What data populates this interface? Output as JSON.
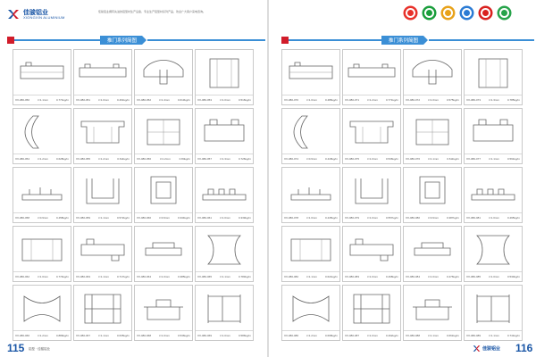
{
  "left_page": {
    "brand_cn": "佳骏铝业",
    "brand_en": "XIONGXIN ALUMINIUM",
    "intro_text": "佳骏铝业拥有先进的铝型材生产设备，专业生产铝型材系列产品，欢迎广大客户来电咨询。",
    "section_title": "推门系列简图",
    "page_number": "115",
    "footnote": "铝型 · 佳骏铝业",
    "cells": [
      {
        "code": "XX-080-050",
        "thick": "t=1.1mm",
        "weight": "0.771kg/m"
      },
      {
        "code": "XX-080-051",
        "thick": "t=1.0mm",
        "weight": "0.461kg/m"
      },
      {
        "code": "XX-080-052",
        "thick": "t=1.4mm",
        "weight": "0.613kg/m"
      },
      {
        "code": "XX-080-053",
        "thick": "t=1.0mm",
        "weight": "0.516kg/m"
      },
      {
        "code": "XX-080-054",
        "thick": "t=1.2mm",
        "weight": "0.628kg/m"
      },
      {
        "code": "XX-080-055",
        "thick": "t=1.2mm",
        "weight": "0.611kg/m"
      },
      {
        "code": "XX-080-056",
        "thick": "t=1.2mm",
        "weight": "0.84kg/m"
      },
      {
        "code": "XX-080-057",
        "thick": "t=1.3mm",
        "weight": "0.726kg/m"
      },
      {
        "code": "XX-080-058",
        "thick": "t=0.9mm",
        "weight": "0.458kg/m"
      },
      {
        "code": "XX-080-059",
        "thick": "t=1.1mm",
        "weight": "0.572kg/m"
      },
      {
        "code": "XX-080-060",
        "thick": "t=0.9mm",
        "weight": "0.334kg/m"
      },
      {
        "code": "XX-080-061",
        "thick": "t=1.0mm",
        "weight": "0.339kg/m"
      },
      {
        "code": "XX-080-062",
        "thick": "t=1.0mm",
        "weight": "0.774kg/m"
      },
      {
        "code": "XX-080-063",
        "thick": "t=1.1mm",
        "weight": "0.717kg/m"
      },
      {
        "code": "XX-080-064",
        "thick": "t=1.0mm",
        "weight": "0.385kg/m"
      },
      {
        "code": "XX-080-065",
        "thick": "t=1.1mm",
        "weight": "0.783kg/m"
      },
      {
        "code": "XX-080-066",
        "thick": "t=1.2mm",
        "weight": "0.889kg/m"
      },
      {
        "code": "XX-080-067",
        "thick": "t=1.1mm",
        "weight": "0.635kg/m"
      },
      {
        "code": "XX-080-068",
        "thick": "t=1.0mm",
        "weight": "0.536kg/m"
      },
      {
        "code": "XX-080-069",
        "thick": "t=1.0mm",
        "weight": "0.586kg/m"
      }
    ]
  },
  "right_page": {
    "section_title": "推门系列简图",
    "page_number": "116",
    "footer_logo_text": "佳骏铝业",
    "cells": [
      {
        "code": "XX-080-070",
        "thick": "t=1.0mm",
        "weight": "0.486kg/m"
      },
      {
        "code": "XX-080-071",
        "thick": "t=1.2mm",
        "weight": "0.771kg/m"
      },
      {
        "code": "XX-080-072",
        "thick": "t=1.0mm",
        "weight": "0.575kg/m"
      },
      {
        "code": "XX-080-073",
        "thick": "t=1.3mm",
        "weight": "0.785kg/m"
      },
      {
        "code": "XX-080-074",
        "thick": "t=0.9mm",
        "weight": "0.418kg/m"
      },
      {
        "code": "XX-080-075",
        "thick": "t=1.0mm",
        "weight": "0.536kg/m"
      },
      {
        "code": "XX-080-076",
        "thick": "t=1.1mm",
        "weight": "0.611kg/m"
      },
      {
        "code": "XX-080-077",
        "thick": "t=1.1mm",
        "weight": "0.591kg/m"
      },
      {
        "code": "XX-080-078",
        "thick": "t=1.0mm",
        "weight": "0.445kg/m"
      },
      {
        "code": "XX-080-079",
        "thick": "t=1.0mm",
        "weight": "0.557kg/m"
      },
      {
        "code": "XX-080-080",
        "thick": "t=0.9mm",
        "weight": "0.387kg/m"
      },
      {
        "code": "XX-080-081",
        "thick": "t=1.0mm",
        "weight": "0.495kg/m"
      },
      {
        "code": "XX-080-082",
        "thick": "t=1.1mm",
        "weight": "0.621kg/m"
      },
      {
        "code": "XX-080-083",
        "thick": "t=1.0mm",
        "weight": "0.468kg/m"
      },
      {
        "code": "XX-080-084",
        "thick": "t=1.0mm",
        "weight": "0.476kg/m"
      },
      {
        "code": "XX-080-085",
        "thick": "t=1.0mm",
        "weight": "0.530kg/m"
      },
      {
        "code": "XX-080-086",
        "thick": "t=1.2mm",
        "weight": "0.668kg/m"
      },
      {
        "code": "XX-080-087",
        "thick": "t=1.0mm",
        "weight": "0.462kg/m"
      },
      {
        "code": "XX-080-088",
        "thick": "t=1.1mm",
        "weight": "0.661kg/m"
      },
      {
        "code": "XX-080-089",
        "thick": "t=1.1mm",
        "weight": "0.741kg/m"
      }
    ]
  },
  "cert_badges": [
    {
      "name": "quality-cert-badge-1",
      "color": "#e8312a"
    },
    {
      "name": "quality-cert-badge-2",
      "color": "#1a9e3c"
    },
    {
      "name": "quality-cert-badge-3",
      "color": "#e8a21a"
    },
    {
      "name": "quality-cert-badge-4",
      "color": "#2b7bd4"
    },
    {
      "name": "quality-cert-badge-5",
      "color": "#d9211f"
    },
    {
      "name": "quality-cert-badge-6",
      "color": "#27a34a"
    }
  ],
  "colors": {
    "accent": "#3b8fd6",
    "brand": "#1a56a6",
    "cap": "#d11c2a"
  }
}
